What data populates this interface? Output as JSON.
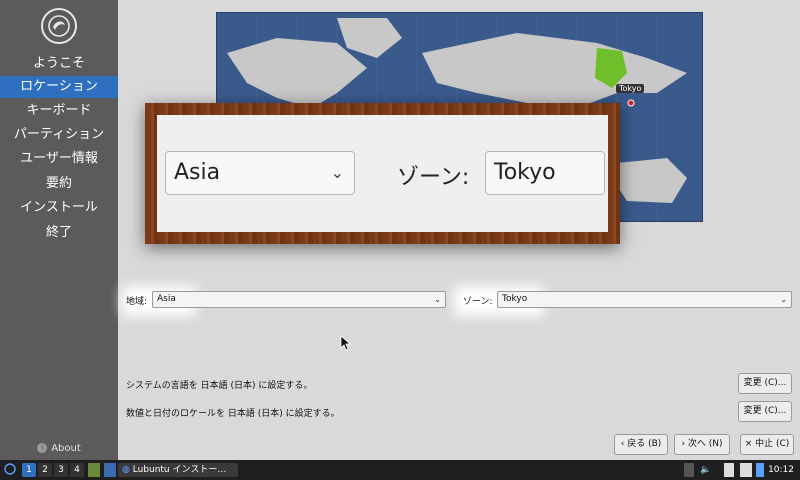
{
  "sidebar": {
    "items": [
      {
        "label": "ようこそ"
      },
      {
        "label": "ロケーション"
      },
      {
        "label": "キーボード"
      },
      {
        "label": "パーティション"
      },
      {
        "label": "ユーザー情報"
      },
      {
        "label": "要約"
      },
      {
        "label": "インストール"
      },
      {
        "label": "終了"
      }
    ],
    "active_index": 1,
    "about_label": "About"
  },
  "map": {
    "selected_city": "Tokyo"
  },
  "zoom": {
    "region_value": "Asia",
    "zone_label": "ゾーン:",
    "zone_value": "Tokyo"
  },
  "form": {
    "region_label": "地域:",
    "region_value": "Asia",
    "zone_label": "ゾーン:",
    "zone_value": "Tokyo"
  },
  "info": {
    "language_text": "システムの言語を 日本語 (日本) に設定する。",
    "locale_text": "数値と日付のロケールを 日本語 (日本) に設定する。",
    "change_label": "変更 (C)..."
  },
  "nav": {
    "back": "戻る (B)",
    "next": "次へ (N)",
    "cancel": "中止 (C)"
  },
  "taskbar": {
    "workspaces": [
      "1",
      "2",
      "3",
      "4"
    ],
    "app_label": "Lubuntu インストー…",
    "clock": "10:12"
  },
  "colors": {
    "accent": "#2f6fbf",
    "sidebar_bg": "#5b5b5b",
    "map_water": "#3b5a8c",
    "map_land": "#c8c8c8",
    "map_highlight": "#6fbf2a"
  }
}
